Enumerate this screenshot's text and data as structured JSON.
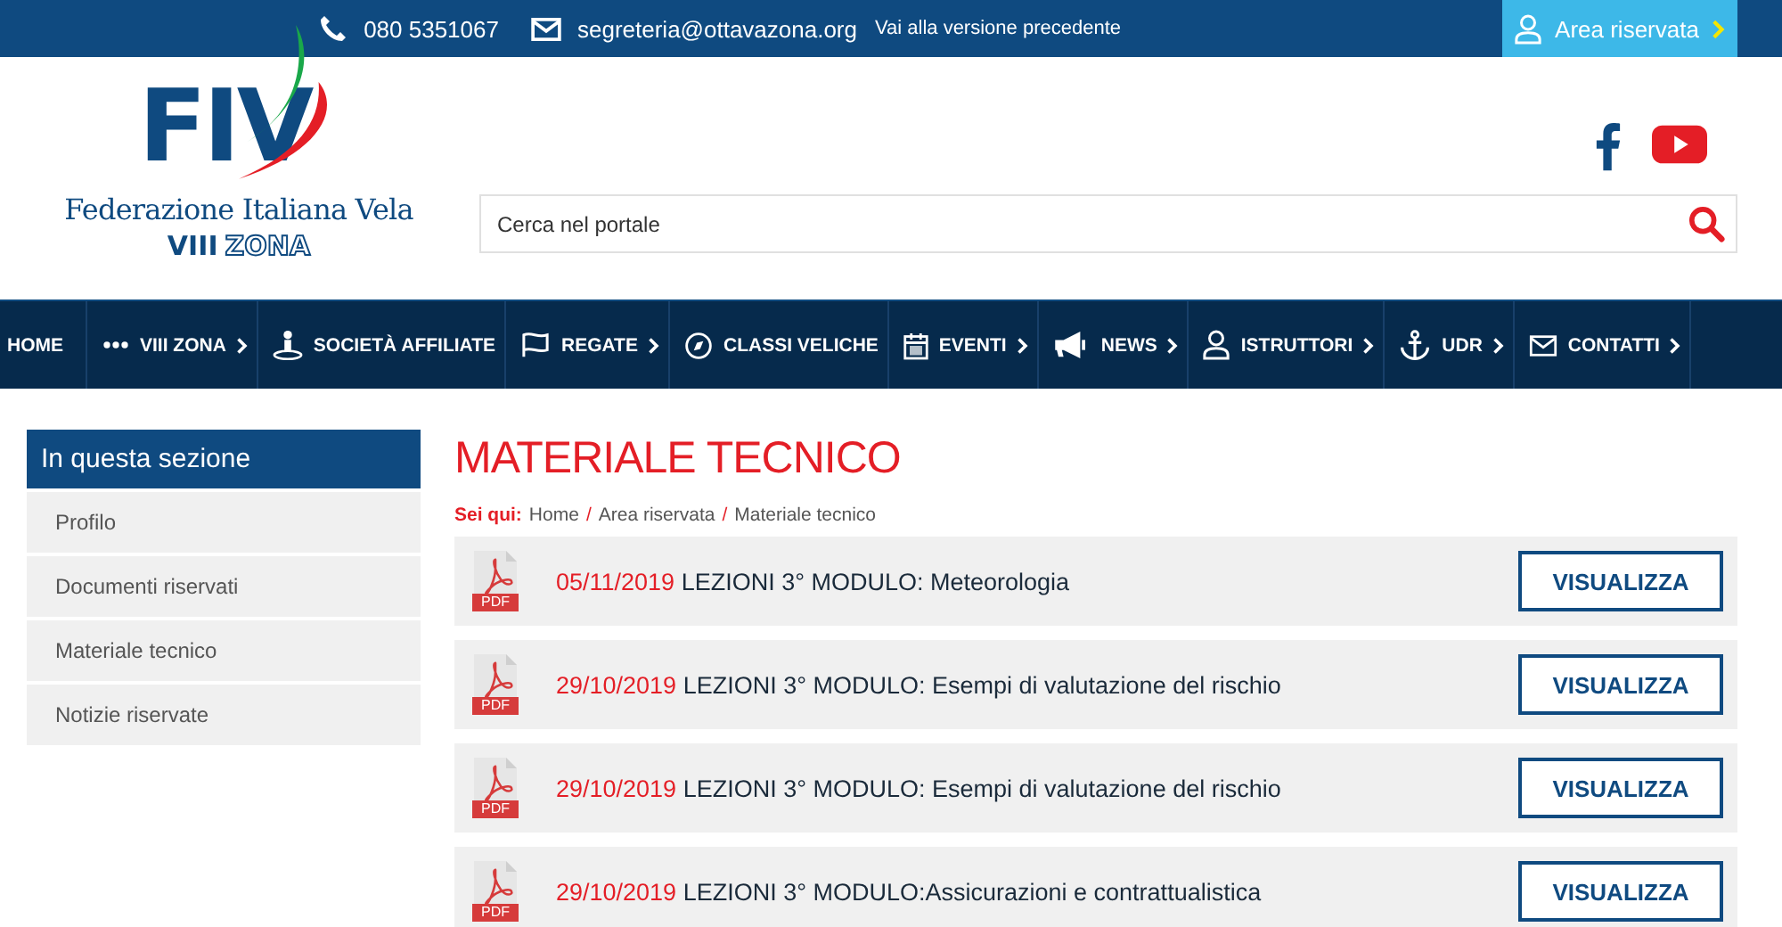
{
  "top_bar": {
    "phone": "080 5351067",
    "email": "segreteria@ottavazona.org",
    "old_version_link": "Vai alla versione precedente",
    "reserved_area_button": "Area riservata"
  },
  "logo": {
    "letters": "FIV",
    "name": "Federazione Italiana Vela",
    "zone_number": "VIII",
    "zone_word": "ZONA"
  },
  "search": {
    "placeholder": "Cerca nel portale"
  },
  "nav": [
    {
      "label": "HOME",
      "kind": "plain",
      "submenu": false
    },
    {
      "label": "VIII ZONA",
      "kind": "dots",
      "submenu": true
    },
    {
      "label": "SOCIETÀ AFFILIATE",
      "kind": "person",
      "submenu": false
    },
    {
      "label": "REGATE",
      "kind": "flag",
      "submenu": true
    },
    {
      "label": "CLASSI VELICHE",
      "kind": "compass",
      "submenu": false
    },
    {
      "label": "EVENTI",
      "kind": "calendar",
      "submenu": true
    },
    {
      "label": "NEWS",
      "kind": "megaphone",
      "submenu": true
    },
    {
      "label": "ISTRUTTORI",
      "kind": "user",
      "submenu": true
    },
    {
      "label": "UDR",
      "kind": "anchor",
      "submenu": true
    },
    {
      "label": "CONTATTI",
      "kind": "mail",
      "submenu": true
    }
  ],
  "sidebar": {
    "title": "In questa sezione",
    "items": [
      "Profilo",
      "Documenti riservati",
      "Materiale tecnico",
      "Notizie riservate"
    ]
  },
  "page": {
    "title": "MATERIALE TECNICO",
    "breadcrumb_label": "Sei qui:",
    "breadcrumb": [
      {
        "kind": "link",
        "text": "Home"
      },
      {
        "kind": "separator",
        "text": "/"
      },
      {
        "kind": "link",
        "text": "Area riservata"
      },
      {
        "kind": "separator",
        "text": "/"
      },
      {
        "kind": "link",
        "text": "Materiale tecnico"
      }
    ]
  },
  "documents": [
    {
      "file_type": "PDF",
      "date": "05/11/2019",
      "title": "LEZIONI 3° MODULO: Meteorologia",
      "button": "VISUALIZZA"
    },
    {
      "file_type": "PDF",
      "date": "29/10/2019",
      "title": "LEZIONI 3° MODULO: Esempi di valutazione del rischio",
      "button": "VISUALIZZA"
    },
    {
      "file_type": "PDF",
      "date": "29/10/2019",
      "title": "LEZIONI 3° MODULO: Esempi di valutazione del rischio",
      "button": "VISUALIZZA"
    },
    {
      "file_type": "PDF",
      "date": "29/10/2019",
      "title": "LEZIONI 3° MODULO:Assicurazioni e contrattualistica",
      "button": "VISUALIZZA"
    }
  ]
}
